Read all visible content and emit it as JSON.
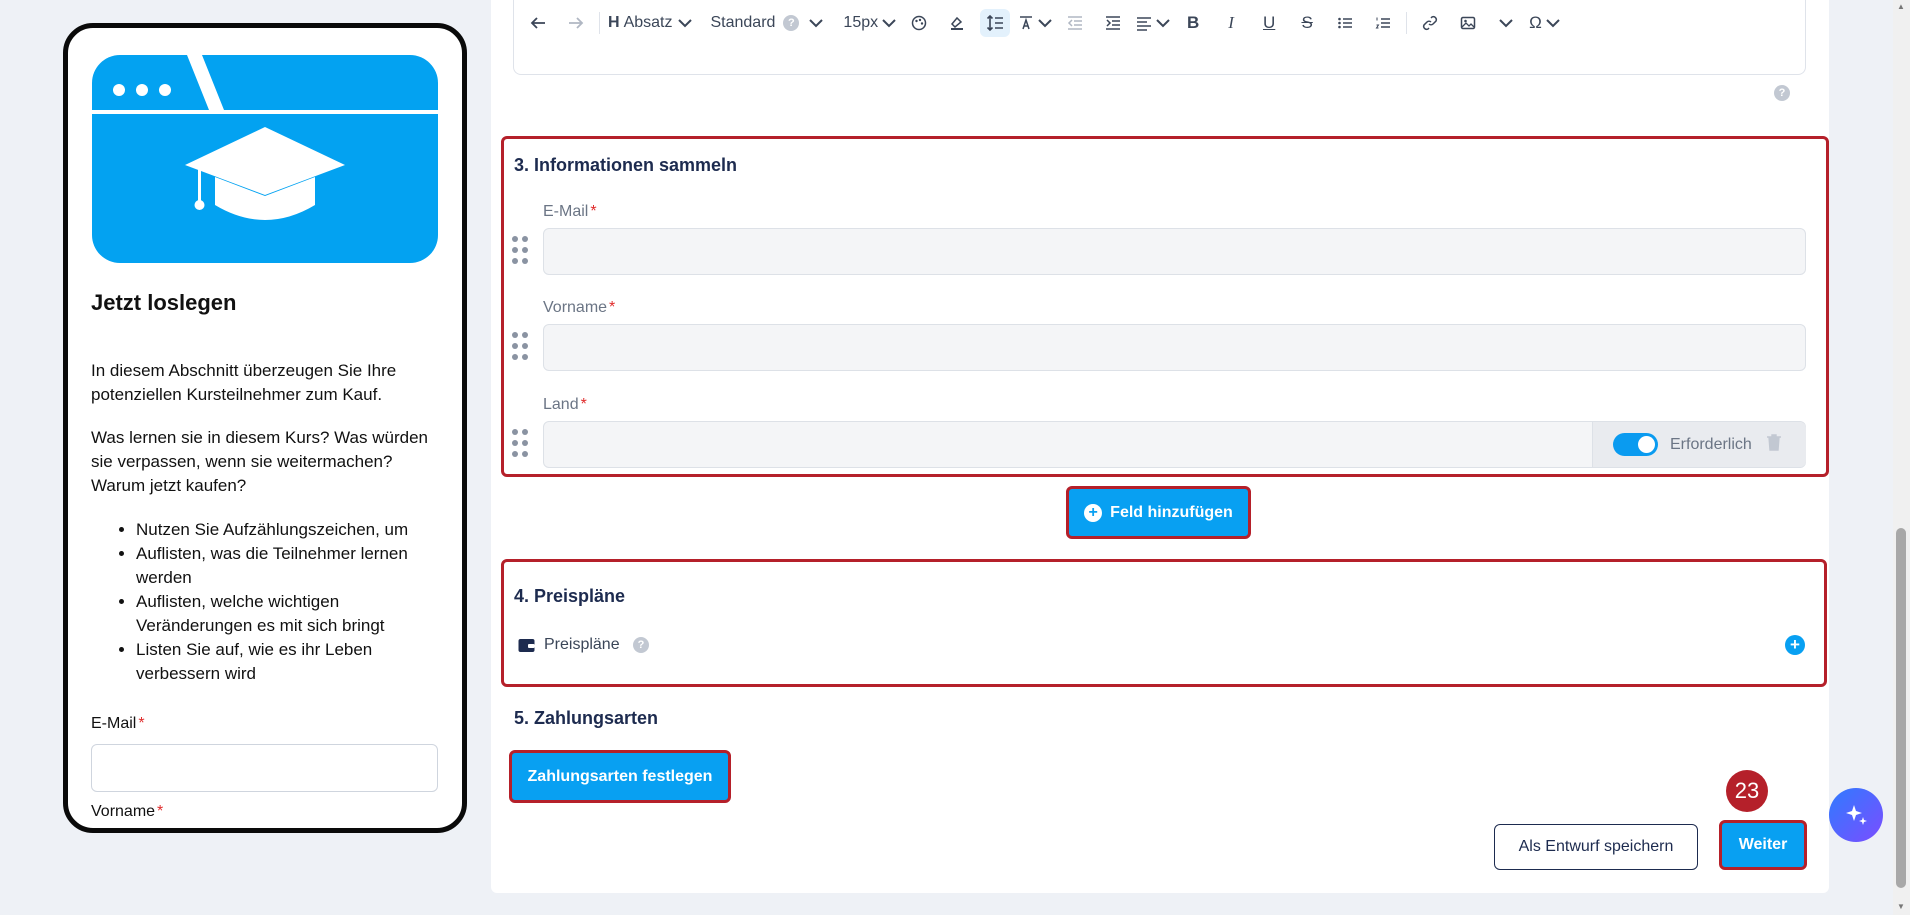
{
  "preview": {
    "title": "Jetzt loslegen",
    "paragraph1": "In diesem Abschnitt überzeugen Sie Ihre potenziellen Kursteilnehmer zum Kauf.",
    "paragraph2": "Was lernen sie in diesem Kurs? Was würden sie verpassen, wenn sie weitermachen? Warum jetzt kaufen?",
    "bullets": [
      "Nutzen Sie Aufzählungszeichen, um",
      "Auflisten, was die Teilnehmer lernen werden",
      "Auflisten, welche wichtigen Veränderungen es mit sich bringt",
      "Listen Sie auf, wie es ihr Leben verbessern wird"
    ],
    "email_label": "E-Mail",
    "firstname_label": "Vorname",
    "required_mark": "*",
    "hero_color": "#03a2f1"
  },
  "toolbar": {
    "heading_label": "Absatz",
    "font_label": "Standard",
    "size_label": "15px",
    "help_mark": "?",
    "icons": [
      "undo-icon",
      "redo-icon",
      "heading-icon",
      "palette-icon",
      "highlight-icon",
      "line-height-icon",
      "text-style-icon",
      "outdent-icon",
      "indent-icon",
      "align-icon",
      "bold-icon",
      "italic-icon",
      "underline-icon",
      "strikethrough-icon",
      "bullet-list-icon",
      "numbered-list-icon",
      "link-icon",
      "image-icon",
      "special-char-icon"
    ]
  },
  "section3": {
    "title": "3. Informationen sammeln",
    "fields": [
      {
        "label": "E-Mail"
      },
      {
        "label": "Vorname"
      },
      {
        "label": "Land"
      }
    ],
    "required_toggle_label": "Erforderlich",
    "add_field_label": "Feld hinzufügen"
  },
  "section4": {
    "title": "4. Preispläne",
    "item_label": "Preispläne"
  },
  "section5": {
    "title": "5. Zahlungsarten",
    "button_label": "Zahlungsarten festlegen"
  },
  "footer": {
    "draft_label": "Als Entwurf speichern",
    "next_label": "Weiter"
  },
  "step_badge": "23",
  "colors": {
    "accent": "#08a0f2",
    "highlight_border": "#b5202a",
    "title_navy": "#1d2b4f"
  }
}
